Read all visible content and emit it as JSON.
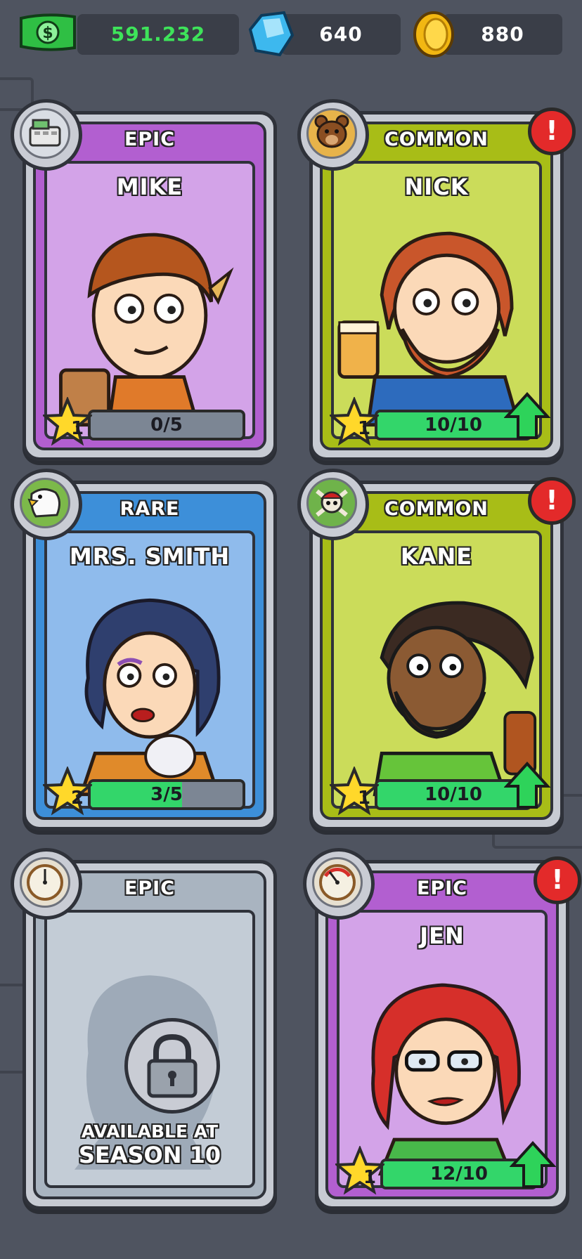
{
  "currencies": {
    "cash": {
      "value": "591.232",
      "icon": "cash-icon"
    },
    "gems": {
      "value": "640",
      "icon": "gem-icon"
    },
    "coins": {
      "value": "880",
      "icon": "coin-icon"
    }
  },
  "colors": {
    "epic": "#b25fd0",
    "epic_light": "#d3a3e8",
    "common": "#a8bd17",
    "common_light": "#cbdc5a",
    "rare": "#3d8fd9",
    "rare_light": "#8fbbec",
    "locked": "#a9b4c0",
    "locked_light": "#c3ccd6",
    "progress_green": "#33d66a",
    "alert_red": "#e32a2a"
  },
  "cards": [
    {
      "rarity": "EPIC",
      "name": "MIKE",
      "level": "1",
      "progress": "0/5",
      "fill": 0.0,
      "badge_icon": "cash-register-icon",
      "alert": false,
      "upgrade": false
    },
    {
      "rarity": "COMMON",
      "name": "NICK",
      "level": "1",
      "progress": "10/10",
      "fill": 1.0,
      "badge_icon": "bear-icon",
      "alert": true,
      "alert_mark": "!",
      "upgrade": true
    },
    {
      "rarity": "RARE",
      "name": "MRS. SMITH",
      "level": "2",
      "progress": "3/5",
      "fill": 0.6,
      "badge_icon": "eagle-icon",
      "alert": false,
      "upgrade": false
    },
    {
      "rarity": "COMMON",
      "name": "KANE",
      "level": "1",
      "progress": "10/10",
      "fill": 1.0,
      "badge_icon": "pirate-skull-icon",
      "alert": true,
      "alert_mark": "!",
      "upgrade": true
    },
    {
      "rarity": "EPIC",
      "locked": true,
      "available_line1": "AVAILABLE AT",
      "available_line2": "SEASON 10",
      "badge_icon": "gauge-icon"
    },
    {
      "rarity": "EPIC",
      "name": "JEN",
      "level": "1",
      "progress": "12/10",
      "fill": 1.0,
      "badge_icon": "gauge-icon",
      "alert": true,
      "alert_mark": "!",
      "upgrade": true
    }
  ]
}
